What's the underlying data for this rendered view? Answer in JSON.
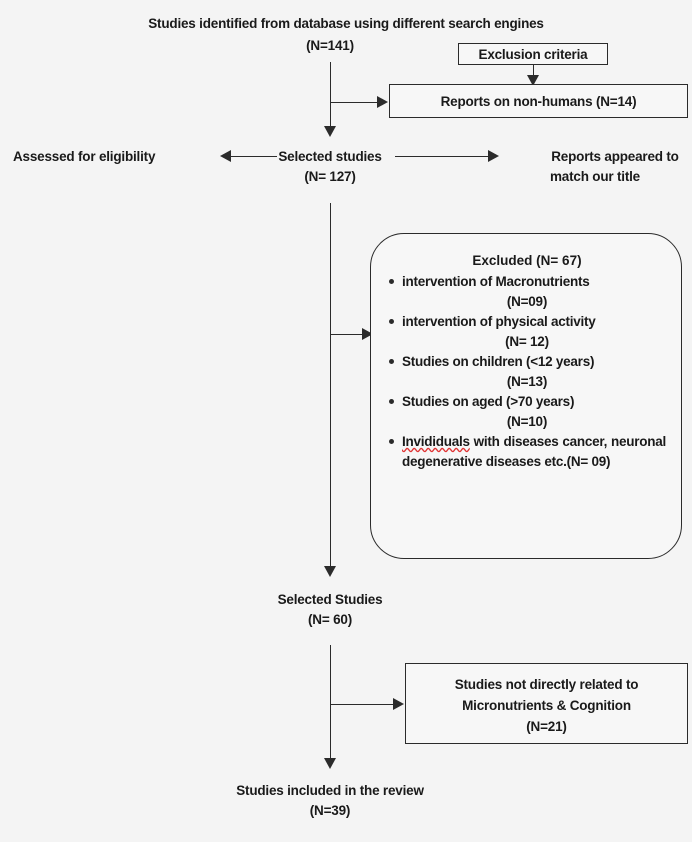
{
  "diagram": {
    "title": "Studies identified from database using different search engines",
    "title_count": "(N=141)",
    "exclusion_criteria_label": "Exclusion criteria",
    "non_humans_box": "Reports on non-humans (N=14)",
    "assessed_label": "Assessed for eligibility",
    "selected_studies_label": "Selected studies",
    "selected_studies_count": "(N= 127)",
    "reports_matched_line1": "Reports appeared to",
    "reports_matched_line2": "match our title",
    "excluded": {
      "heading": "Excluded (N= 67)",
      "items": [
        {
          "text": "intervention of Macronutrients",
          "count": "(N=09)",
          "justified": false,
          "misspelled": ""
        },
        {
          "text": "intervention of physical activity",
          "count": "(N= 12)",
          "justified": false,
          "misspelled": ""
        },
        {
          "text": "Studies on children (<12 years)",
          "count": "(N=13)",
          "justified": false,
          "misspelled": ""
        },
        {
          "text": "Studies on aged (>70 years)",
          "count": "(N=10)",
          "justified": false,
          "misspelled": ""
        },
        {
          "text": "Invididuals with diseases cancer, neuronal degenerative diseases etc.(N= 09)",
          "count": "",
          "justified": true,
          "misspelled": "Invididuals"
        }
      ]
    },
    "selected_studies_2_label": "Selected Studies",
    "selected_studies_2_count": "(N= 60)",
    "not_related_line1": "Studies not directly related to",
    "not_related_line2": "Micronutrients & Cognition",
    "not_related_count": "(N=21)",
    "included_label": "Studies included in the review",
    "included_count": "(N=39)"
  },
  "colors": {
    "background": "#f4f4f4",
    "stroke": "#2b2b2b",
    "text": "#1a1a1a",
    "box_fill": "#f7f7f7",
    "spellcheck": "#e03434"
  }
}
